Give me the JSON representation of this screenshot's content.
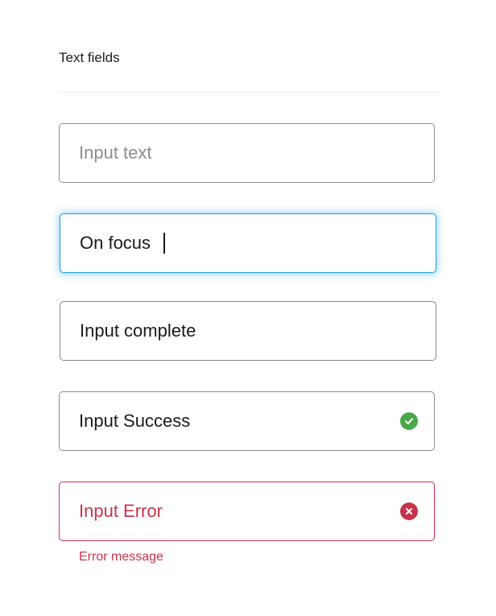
{
  "section": {
    "title": "Text fields"
  },
  "fields": {
    "default": {
      "placeholder": "Input text",
      "value": ""
    },
    "focus": {
      "value": "On focus"
    },
    "complete": {
      "value": "Input complete"
    },
    "success": {
      "value": "Input Success",
      "icon": "check-circle-icon"
    },
    "error": {
      "value": "Input Error",
      "icon": "x-circle-icon",
      "message": "Error message"
    }
  },
  "colors": {
    "focus_border": "#1aa0e0",
    "success": "#4aa84a",
    "error": "#c8334a",
    "border": "#8f8f8f"
  }
}
